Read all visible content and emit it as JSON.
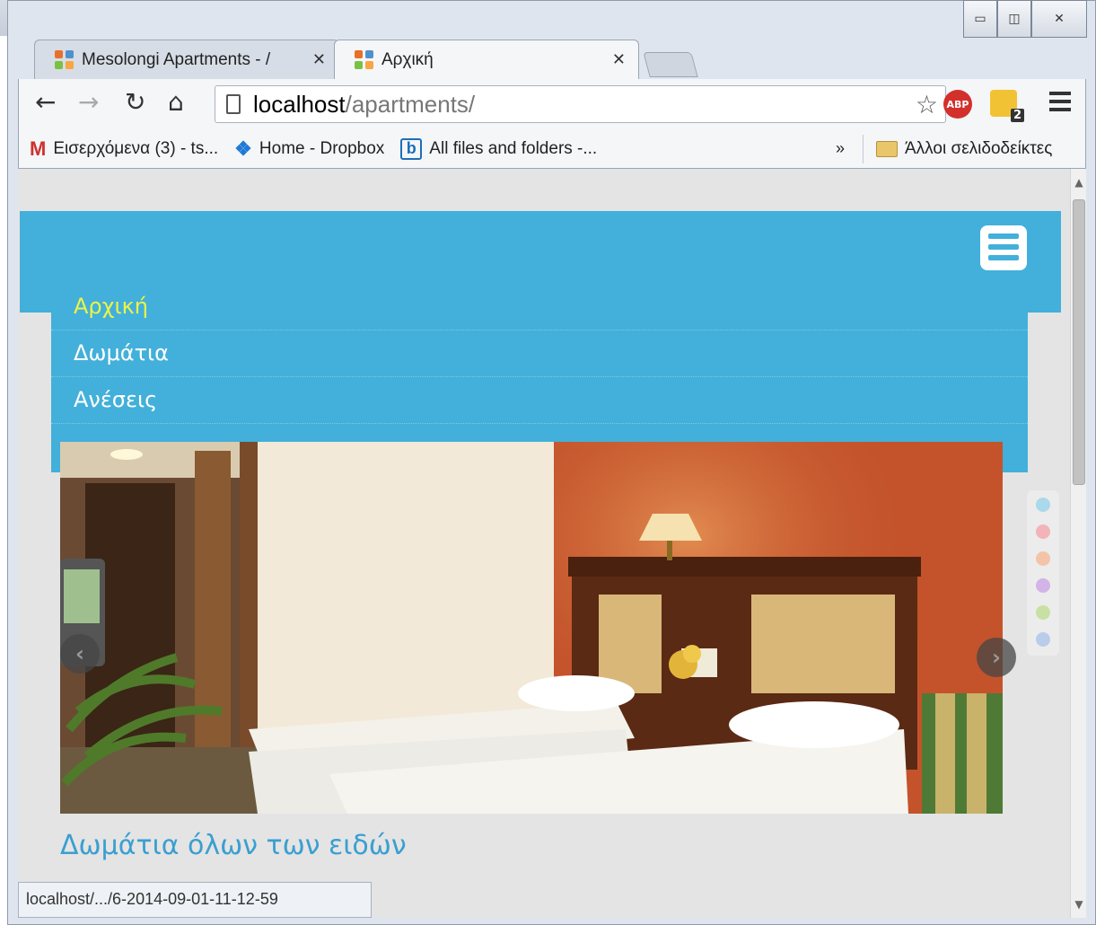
{
  "browser": {
    "tabs": [
      {
        "title": "Mesolongi Apartments - /",
        "active": false
      },
      {
        "title": "Αρχική",
        "active": true
      }
    ],
    "url_host": "localhost",
    "url_path": "/apartments/",
    "extensions": {
      "abp_label": "ABP",
      "badge_count": "2"
    },
    "bookmarks": [
      {
        "label": "Εισερχόμενα (3) - ts...",
        "icon": "gmail-icon"
      },
      {
        "label": "Home - Dropbox",
        "icon": "dropbox-icon"
      },
      {
        "label": "All files and folders -...",
        "icon": "box-icon"
      }
    ],
    "bookmarks_overflow": "»",
    "other_bookmarks": "Άλλοι σελιδοδείκτες",
    "status_url": "localhost/.../6-2014-09-01-11-12-59"
  },
  "site": {
    "accent_color": "#42b0da",
    "menu": [
      {
        "label": "Αρχική",
        "active": true
      },
      {
        "label": "Δωμάτια",
        "active": false
      },
      {
        "label": "Ανέσεις",
        "active": false
      }
    ],
    "slider": {
      "dots": [
        "#a9d9ea",
        "#f2b4b8",
        "#f3c4a8",
        "#d2b4e6",
        "#c9e0a4",
        "#b9cdea"
      ]
    },
    "caption": "Δωμάτια όλων των ειδών"
  }
}
